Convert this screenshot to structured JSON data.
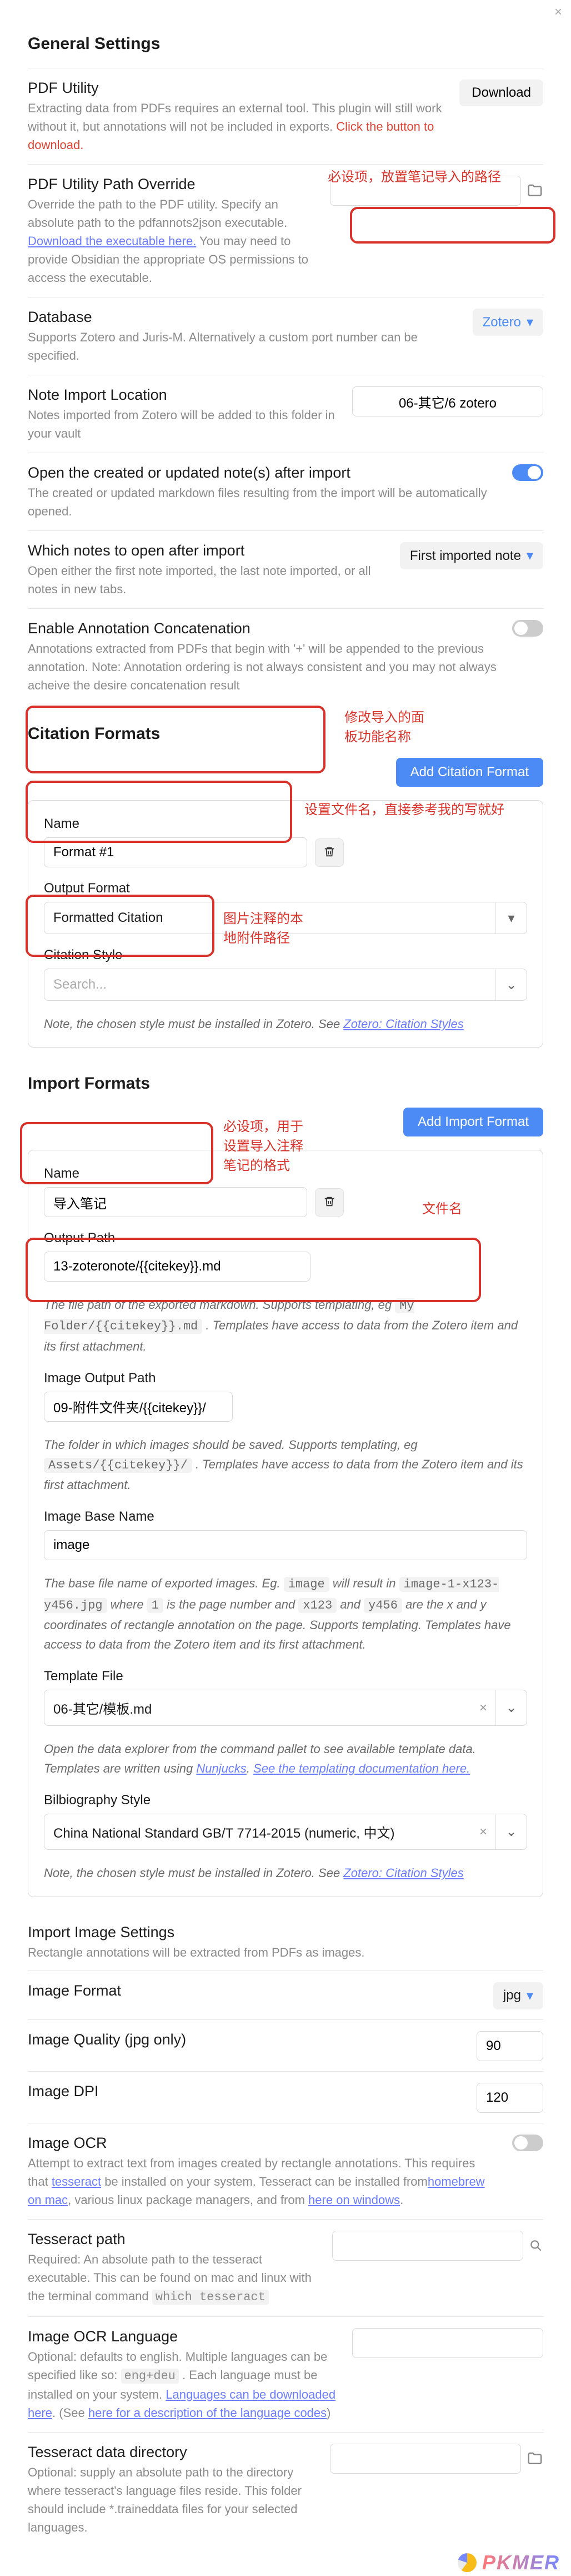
{
  "close_glyph": "×",
  "general": {
    "title": "General Settings",
    "pdf_utility": {
      "title": "PDF Utility",
      "desc_a": "Extracting data from PDFs requires an external tool. This plugin will still work without it, but annotations will not be included in exports. ",
      "desc_red": "Click the button to download.",
      "button": "Download"
    },
    "pdf_path": {
      "title": "PDF Utility Path Override",
      "desc_a": "Override the path to the PDF utility. Specify an absolute path to the pdfannots2json executable. ",
      "desc_link": "Download the executable here.",
      "desc_b": " You may need to provide Obsidian the appropriate OS permissions to access the executable.",
      "placeholder": ""
    },
    "database": {
      "title": "Database",
      "desc": "Supports Zotero and Juris-M. Alternatively a custom port number can be specified.",
      "value": "Zotero"
    },
    "note_import": {
      "title": "Note Import Location",
      "desc": "Notes imported from Zotero will be added to this folder in your vault",
      "value": "06-其它/6 zotero"
    },
    "open_after": {
      "title": "Open the created or updated note(s) after import",
      "desc": "The created or updated markdown files resulting from the import will be automatically opened.",
      "on": true
    },
    "which_open": {
      "title": "Which notes to open after import",
      "desc": "Open either the first note imported, the last note imported, or all notes in new tabs.",
      "value": "First imported note"
    },
    "annot_concat": {
      "title": "Enable Annotation Concatenation",
      "desc": "Annotations extracted from PDFs that begin with '+' will be appended to the previous annotation. Note: Annotation ordering is not always consistent and you may not always acheive the desire concatenation result",
      "on": false
    }
  },
  "citation": {
    "title": "Citation Formats",
    "add_button": "Add Citation Format",
    "name_label": "Name",
    "name_value": "Format #1",
    "output_label": "Output Format",
    "output_value": "Formatted Citation",
    "style_label": "Citation Style",
    "style_placeholder": "Search...",
    "note_a": "Note, the chosen style must be installed in Zotero. See ",
    "note_link": "Zotero: Citation Styles"
  },
  "import": {
    "title": "Import Formats",
    "add_button": "Add Import Format",
    "name_label": "Name",
    "name_value": "导入笔记",
    "output_path_label": "Output Path",
    "output_path_value": "13-zoteronote/{{citekey}}.md",
    "output_path_note_a": "The file path of the exported markdown. Supports templating, eg ",
    "output_path_note_code": "My Folder/{{citekey}}.md",
    "output_path_note_b": " . Templates have access to data from the Zotero item and its first attachment.",
    "image_path_label": "Image Output Path",
    "image_path_value": "09-附件文件夹/{{citekey}}/",
    "image_path_note_a": "The folder in which images should be saved. Supports templating, eg ",
    "image_path_note_code": "Assets/{{citekey}}/",
    "image_path_note_b": " . Templates have access to data from the Zotero item and its first attachment.",
    "image_base_label": "Image Base Name",
    "image_base_value": "image",
    "image_base_note_a": "The base file name of exported images. Eg. ",
    "image_base_note_code1": "image",
    "image_base_note_b": " will result in ",
    "image_base_note_code2": "image-1-x123-y456.jpg",
    "image_base_note_c": " where ",
    "image_base_note_code3": "1",
    "image_base_note_d": " is the page number and ",
    "image_base_note_code4": "x123",
    "image_base_note_e": " and ",
    "image_base_note_code5": "y456",
    "image_base_note_f": " are the x and y coordinates of rectangle annotation on the page. Supports templating. Templates have access to data from the Zotero item and its first attachment.",
    "template_label": "Template File",
    "template_value": "06-其它/模板.md",
    "template_note_a": "Open the data explorer from the command pallet to see available template data. Templates are written using ",
    "template_note_link1": "Nunjucks",
    "template_note_b": ". ",
    "template_note_link2": "See the templating documentation here.",
    "bib_label": "Bilbiography Style",
    "bib_value": "China National Standard GB/T 7714-2015 (numeric, 中文)",
    "bib_note_a": "Note, the chosen style must be installed in Zotero. See ",
    "bib_note_link": "Zotero: Citation Styles"
  },
  "image_settings": {
    "title": "Import Image Settings",
    "desc": "Rectangle annotations will be extracted from PDFs as images.",
    "format_label": "Image Format",
    "format_value": "jpg",
    "quality_label": "Image Quality (jpg only)",
    "quality_value": "90",
    "dpi_label": "Image DPI",
    "dpi_value": "120",
    "ocr_label": "Image OCR",
    "ocr_desc_a": "Attempt to extract text from images created by rectangle annotations. This requires that ",
    "ocr_desc_link1": "tesseract",
    "ocr_desc_b": " be installed on your system. Tesseract can be installed from",
    "ocr_desc_link2": "homebrew on mac",
    "ocr_desc_c": ", various linux package managers, and from ",
    "ocr_desc_link3": "here on windows",
    "ocr_desc_d": ".",
    "tess_path_label": "Tesseract path",
    "tess_path_desc_a": "Required: An absolute path to the tesseract executable. This can be found on mac and linux with the terminal command ",
    "tess_path_desc_code": "which tesseract",
    "ocr_lang_label": "Image OCR Language",
    "ocr_lang_desc_a": "Optional: defaults to english. Multiple languages can be specified like so: ",
    "ocr_lang_desc_code": "eng+deu",
    "ocr_lang_desc_b": " . Each language must be installed on your system. ",
    "ocr_lang_desc_link1": "Languages can be downloaded here",
    "ocr_lang_desc_c": ". (See ",
    "ocr_lang_desc_link2": "here for a description of the language codes",
    "ocr_lang_desc_d": ")",
    "tess_data_label": "Tesseract data directory",
    "tess_data_desc": "Optional: supply an absolute path to the directory where tesseract's language files reside. This folder should include *.traineddata files for your selected languages."
  },
  "annotations": {
    "a1": "必设项，放置笔记导入的路径",
    "a2": "修改导入的面\n板功能名称",
    "a3": "设置文件名，直接参考我的写就好",
    "a4": "图片注释的本\n地附件路径",
    "a5": "必设项，用于\n设置导入注释\n笔记的格式",
    "a6": "文件名"
  },
  "watermark": "PKMER"
}
